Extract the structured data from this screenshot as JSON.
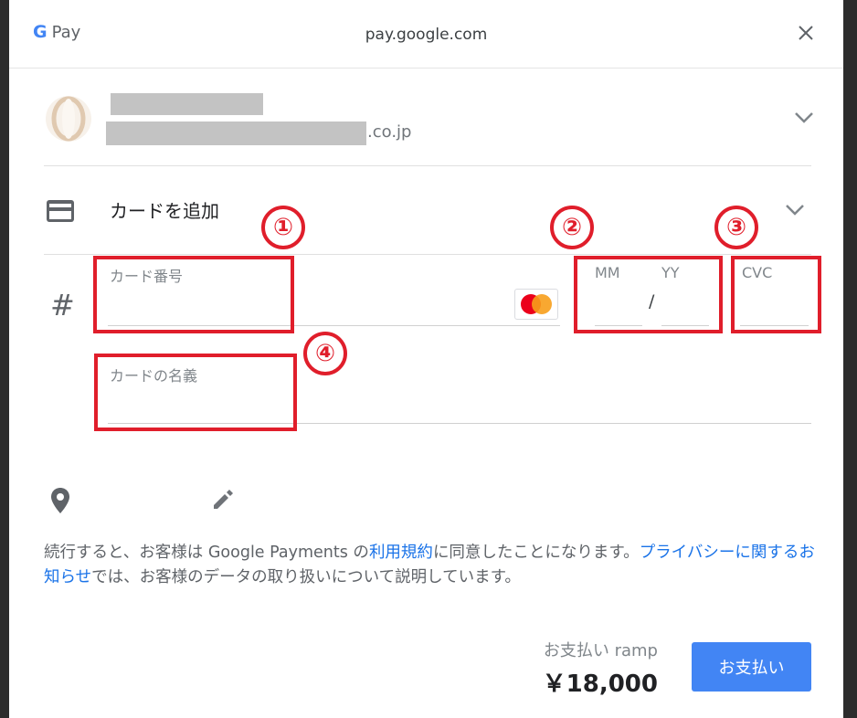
{
  "titlebar": {
    "brand_g": "G",
    "brand_pay": "Pay",
    "domain": "pay.google.com",
    "close_icon": "close-icon"
  },
  "account": {
    "email_suffix": ".co.jp",
    "expand_icon": "chevron-down-icon"
  },
  "payment_method": {
    "label": "カードを追加",
    "icon": "credit-card-icon",
    "expand_icon": "chevron-down-icon"
  },
  "card_form": {
    "number_label": "カード番号",
    "number_value": "",
    "month_label": "MM",
    "year_label": "YY",
    "separator": "/",
    "cvc_label": "CVC",
    "name_label": "カードの名義",
    "name_value": "",
    "brand_icon": "mastercard-icon"
  },
  "annotations": [
    "①",
    "②",
    "③",
    "④"
  ],
  "address": {
    "location_icon": "location-pin-icon",
    "edit_icon": "pencil-icon"
  },
  "terms": {
    "part1": "続行すると、お客様は Google Payments の",
    "tos_link": "利用規約",
    "part2": "に同意したことになります。",
    "privacy_link": "プライバシーに関するお知らせ",
    "part3": "では、お客様のデータの取り扱いについて説明しています。"
  },
  "checkout": {
    "pay_to_label": "お支払い ramp",
    "amount": "￥18,000",
    "pay_button": "お支払い"
  },
  "colors": {
    "accent": "#4285f4",
    "link": "#1a73e8",
    "annotation_red": "#e01e2b"
  }
}
